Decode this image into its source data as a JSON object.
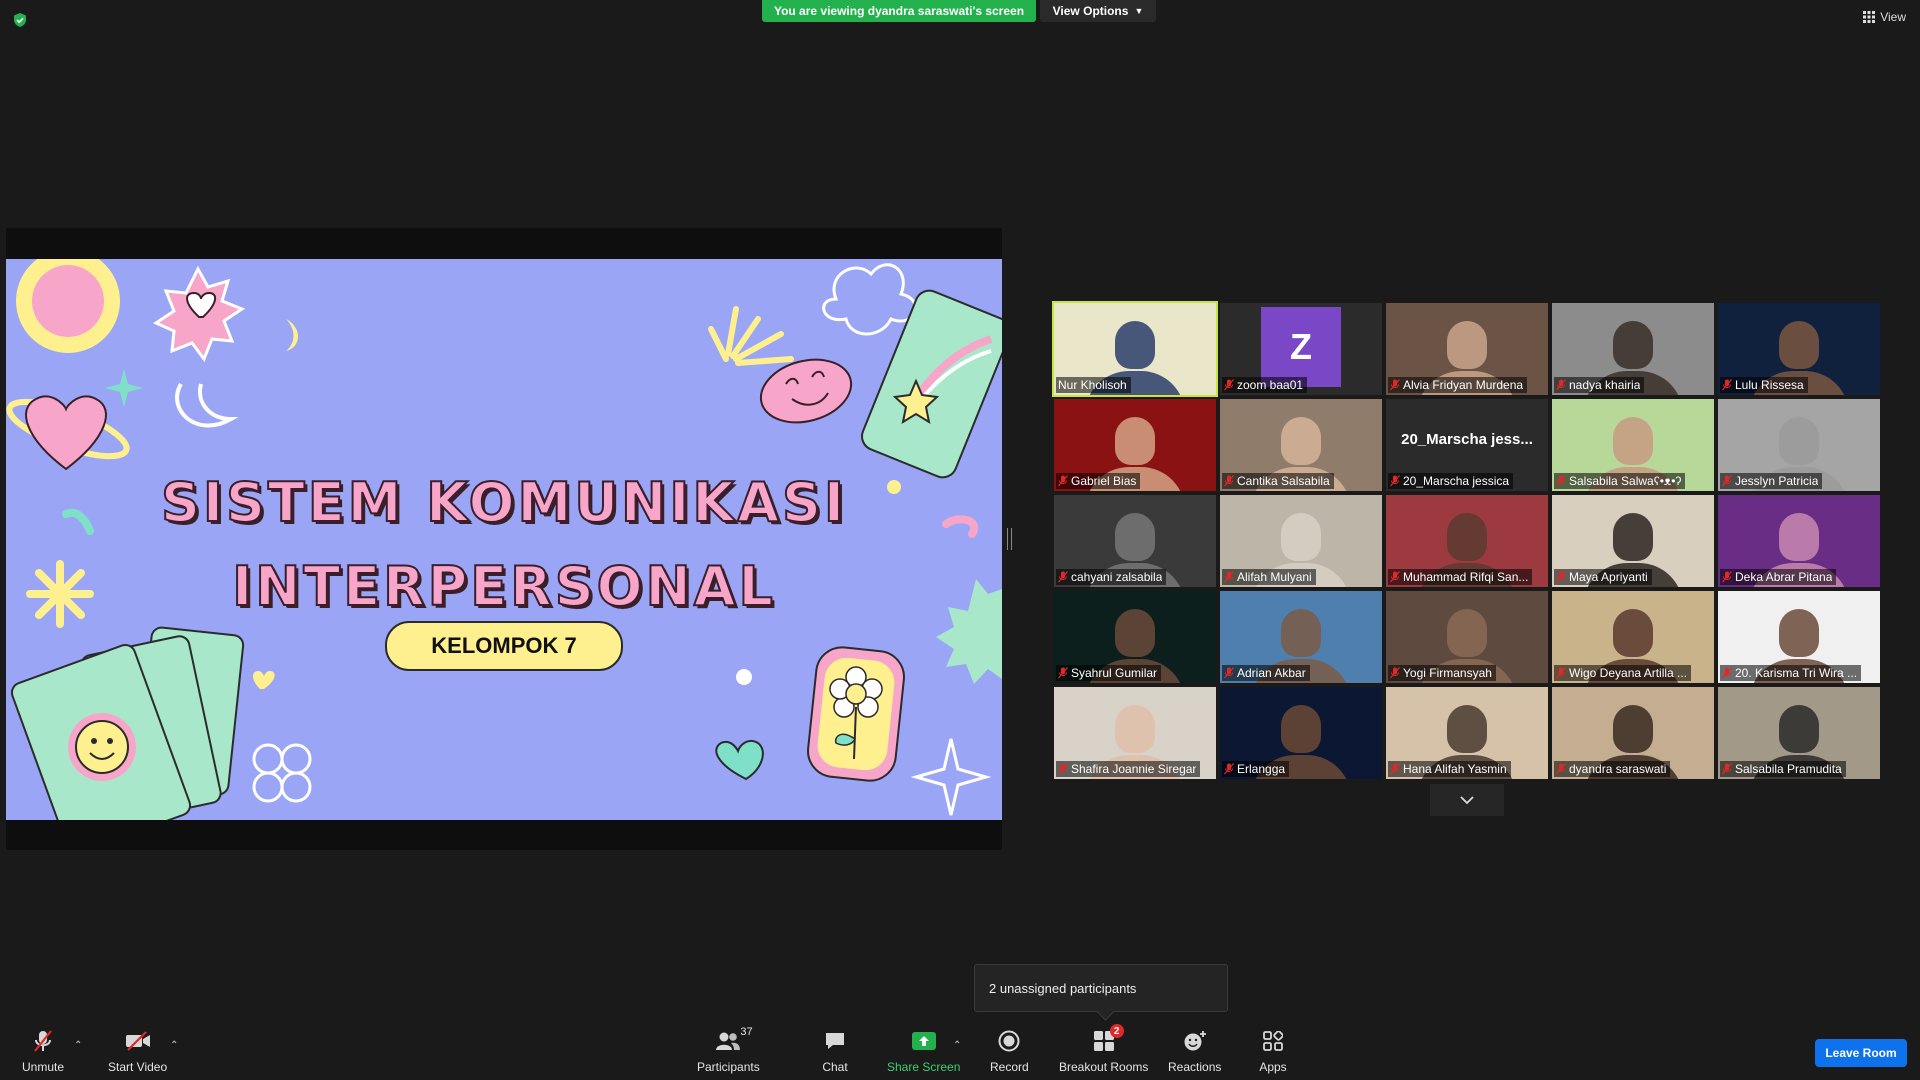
{
  "top": {
    "banner": "You are viewing dyandra saraswati's screen",
    "view_options": "View Options",
    "view": "View"
  },
  "slide": {
    "title_line1": "SISTEM KOMUNIKASI",
    "title_line2": "INTERPERSONAL",
    "group": "KELOMPOK 7"
  },
  "participants": [
    {
      "name": "Nur Kholisoh",
      "muted": false,
      "active": true,
      "bg": "#e9e6c9",
      "skin": "#2a3d6b"
    },
    {
      "name": "zoom baa01",
      "muted": true,
      "avatar": "Z"
    },
    {
      "name": "Alvia Fridyan Murdena",
      "muted": true,
      "bg": "#6b5446",
      "skin": "#c9a58a"
    },
    {
      "name": "nadya khairia",
      "muted": true,
      "bg": "#8c8c8c",
      "skin": "#3a2f2a"
    },
    {
      "name": "Lulu Rissesa",
      "muted": true,
      "bg": "#10213d",
      "skin": "#7a5641"
    },
    {
      "name": "Gabriel Bias",
      "muted": true,
      "bg": "#8a1212",
      "skin": "#d2a384"
    },
    {
      "name": "Cantika Salsabila",
      "muted": true,
      "bg": "#8f7c6a",
      "skin": "#d6b59a"
    },
    {
      "name": "20_Marscha jessica",
      "muted": true,
      "bigname": "20_Marscha jess..."
    },
    {
      "name": "Salsabila Salwaʕ•ᴥ•ʔ",
      "muted": true,
      "bg": "#b8d89a",
      "skin": "#c79b82"
    },
    {
      "name": "Jesslyn Patricia",
      "muted": true,
      "bg": "#a5a5a5",
      "skin": "#9a9a9a"
    },
    {
      "name": "cahyani zalsabila",
      "muted": true,
      "bg": "#3a3a3a",
      "skin": "#777"
    },
    {
      "name": "Alifah Mulyani",
      "muted": true,
      "bg": "#bdb5a8",
      "skin": "#d8d0c4"
    },
    {
      "name": "Muhammad Rifqi San...",
      "muted": true,
      "bg": "#9c3a3f",
      "skin": "#5a3b30"
    },
    {
      "name": "Maya Apriyanti",
      "muted": true,
      "bg": "#d9cfbf",
      "skin": "#2b2420"
    },
    {
      "name": "Deka Abrar Pitana",
      "muted": true,
      "bg": "#6a2d86",
      "skin": "#c88ab0"
    },
    {
      "name": "Syahrul Gumilar",
      "muted": true,
      "bg": "#0d1f1c",
      "skin": "#6a4a3a"
    },
    {
      "name": "Adrian Akbar",
      "muted": true,
      "bg": "#4e7fae",
      "skin": "#7d5a45"
    },
    {
      "name": "Yogi Firmansyah",
      "muted": true,
      "bg": "#5e4a3e",
      "skin": "#8a6a55"
    },
    {
      "name": "Wigo Deyana Artilla ...",
      "muted": true,
      "bg": "#c9b38b",
      "skin": "#5a3a2e"
    },
    {
      "name": "20. Karisma Tri Wira ...",
      "muted": true,
      "bg": "#f0f0f0",
      "skin": "#6b4a3a"
    },
    {
      "name": "Shafira Joannie Siregar",
      "muted": true,
      "bg": "#d8d2c9",
      "skin": "#e0c0a8"
    },
    {
      "name": "Erlangga",
      "muted": true,
      "bg": "#0b1733",
      "skin": "#6a4a35"
    },
    {
      "name": "Hana Alifah Yasmin",
      "muted": true,
      "bg": "#d6c2a8",
      "skin": "#4a3a30"
    },
    {
      "name": "dyandra saraswati",
      "muted": true,
      "bg": "#c4ad90",
      "skin": "#3a2a22"
    },
    {
      "name": "Salsabila Pramudita",
      "muted": true,
      "bg": "#a39988",
      "skin": "#2a2a2a"
    }
  ],
  "tooltip": "2 unassigned participants",
  "toolbar": {
    "unmute": "Unmute",
    "start_video": "Start Video",
    "participants": "Participants",
    "participants_count": "37",
    "chat": "Chat",
    "share_screen": "Share Screen",
    "record": "Record",
    "breakout_rooms": "Breakout Rooms",
    "breakout_badge": "2",
    "reactions": "Reactions",
    "apps": "Apps",
    "leave_room": "Leave Room"
  },
  "colors": {
    "accent_green": "#23b14d",
    "leave_blue": "#0e72ed",
    "slide_bg": "#9aa6f5",
    "active_speaker": "#c6e63a"
  }
}
